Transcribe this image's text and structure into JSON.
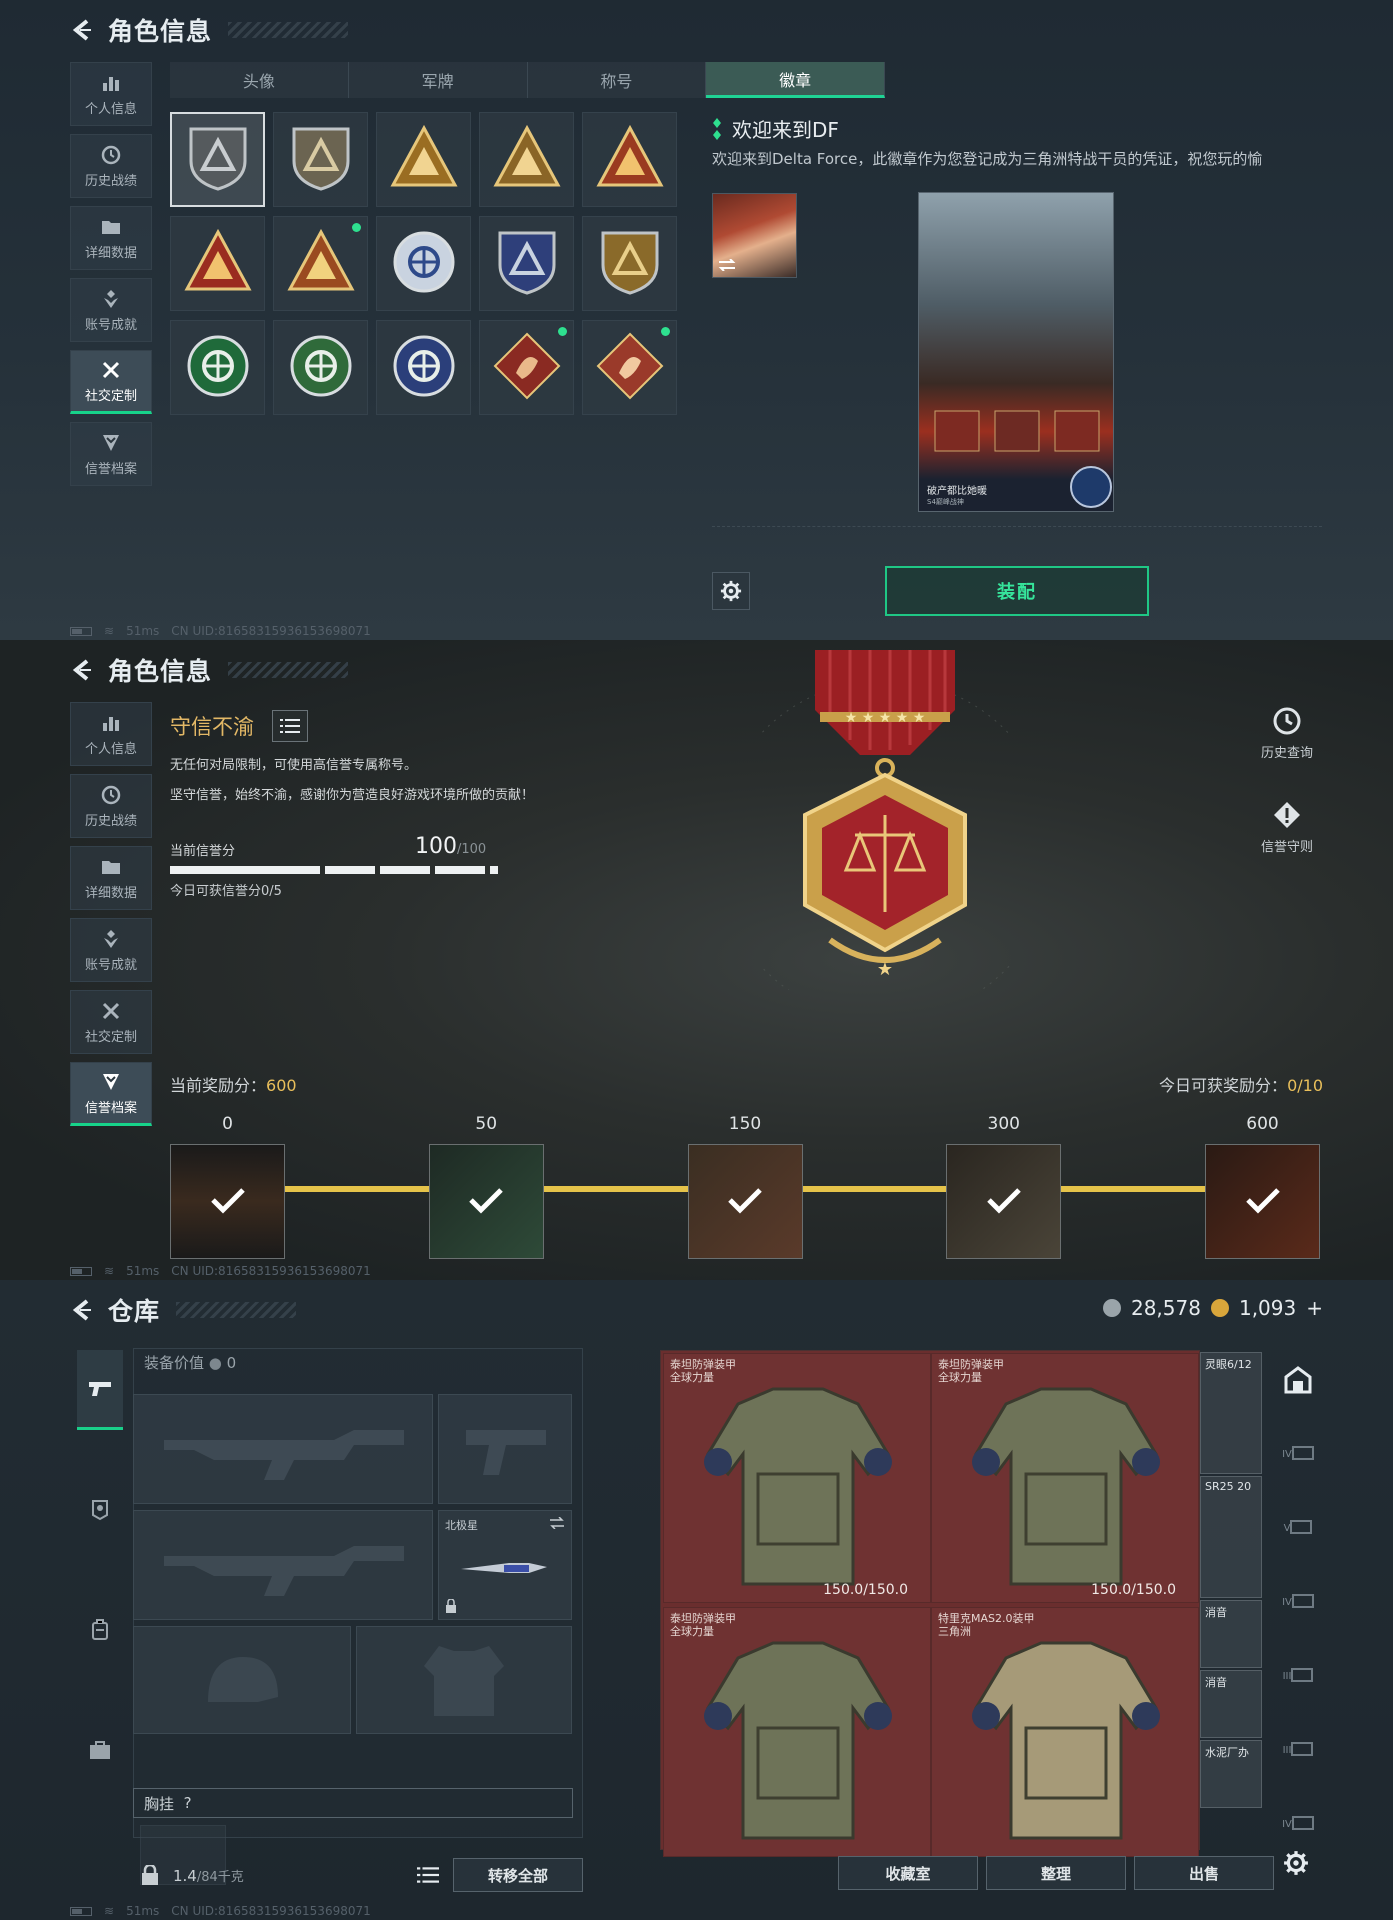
{
  "status": {
    "ping": "51ms",
    "uid": "CN UID:8165831593615369807​1"
  },
  "s1": {
    "title": "角色信息",
    "nav": [
      {
        "label": "个人信息",
        "icon": "bar-chart-icon"
      },
      {
        "label": "历史战绩",
        "icon": "clock-icon"
      },
      {
        "label": "详细数据",
        "icon": "folder-icon"
      },
      {
        "label": "账号成就",
        "icon": "achievement-icon"
      },
      {
        "label": "社交定制",
        "icon": "tools-icon",
        "active": true
      },
      {
        "label": "信誉档案",
        "icon": "shield-chevron-icon"
      }
    ],
    "tabs": [
      "头像",
      "军牌",
      "称号",
      "徽章"
    ],
    "active_tab": "徽章",
    "badges": [
      {
        "name": "delta-triangle-badge",
        "new": false
      },
      {
        "name": "helicopter-badge",
        "new": false
      },
      {
        "name": "money-bag-badge",
        "new": false
      },
      {
        "name": "card-badge",
        "new": false
      },
      {
        "name": "boat-badge",
        "new": false
      },
      {
        "name": "rank-one-badge",
        "new": false
      },
      {
        "name": "tower-badge",
        "new": true
      },
      {
        "name": "star-circle-badge",
        "new": false
      },
      {
        "name": "blue-shield-badge",
        "new": false
      },
      {
        "name": "gold-shield-badge",
        "new": false
      },
      {
        "name": "green-rifle-badge",
        "new": false
      },
      {
        "name": "green-sniper-badge",
        "new": false
      },
      {
        "name": "blue-tools-badge",
        "new": false
      },
      {
        "name": "dragon-badge",
        "new": true
      },
      {
        "name": "fox-badge",
        "new": true
      }
    ],
    "detail_title": "欢迎来到DF",
    "detail_desc": "欢迎来到Delta Force，此徽章作为您登记成为三角洲特战干员的凭证，祝您玩的愉",
    "poster_caption": "破产都比她暖",
    "poster_sub": "S4巅峰战神",
    "equip_label": "装配"
  },
  "s2": {
    "title": "角色信息",
    "nav": [
      {
        "label": "个人信息",
        "icon": "bar-chart-icon"
      },
      {
        "label": "历史战绩",
        "icon": "clock-icon"
      },
      {
        "label": "详细数据",
        "icon": "folder-icon"
      },
      {
        "label": "账号成就",
        "icon": "achievement-icon"
      },
      {
        "label": "社交定制",
        "icon": "tools-icon"
      },
      {
        "label": "信誉档案",
        "icon": "shield-chevron-icon",
        "active": true
      }
    ],
    "rank_name": "守信不渝",
    "line1": "无任何对局限制，可使用高信誉专属称号。",
    "line2": "坚守信誉，始终不渝，感谢你为营造良好游戏环境所做的贡献！",
    "score_label": "当前信誉分",
    "score": "100",
    "score_max": "/100",
    "score_fraction": 1.0,
    "today_text": "今日可获信誉分0/5",
    "history_btn": "历史查询",
    "rules_btn": "信誉守则",
    "reward_label": "当前奖励分：",
    "reward_value": "600",
    "today_reward_label": "今日可获奖励分：",
    "today_reward_value": "0/10",
    "milestones": [
      {
        "value": "0",
        "claimed": true
      },
      {
        "value": "50",
        "claimed": true
      },
      {
        "value": "150",
        "claimed": true
      },
      {
        "value": "300",
        "claimed": true
      },
      {
        "value": "600",
        "claimed": true
      }
    ]
  },
  "s3": {
    "title": "仓库",
    "currency1": "28,578",
    "currency2": "1,093",
    "plus": "+",
    "equip_value_label": "装备价值",
    "equip_value": "0",
    "knife_name": "北极星",
    "chest_label": "胸挂",
    "chest_hint": "?",
    "capacity": "1.4",
    "capacity_unit": "/84千克",
    "move_all": "转移全部",
    "items": [
      {
        "name": "泰坦防弹装甲",
        "sub": "全球力量",
        "durability": "150.0/150.0"
      },
      {
        "name": "泰坦防弹装甲",
        "sub": "全球力量",
        "durability": "150.0/150.0"
      },
      {
        "name": "泰坦防弹装甲",
        "sub": "全球力量",
        "durability": ""
      },
      {
        "name": "特里克MAS2.0装甲",
        "sub": "三角洲",
        "durability": ""
      }
    ],
    "small_items": [
      "灵眼6/12",
      "SR25 20",
      "消音",
      "消音",
      "水泥厂办"
    ],
    "btn_collect": "收藏室",
    "btn_sort": "整理",
    "btn_sell": "出售",
    "rside_labels": [
      "",
      "IV",
      "V",
      "IV",
      "III",
      "III",
      "IV"
    ]
  }
}
